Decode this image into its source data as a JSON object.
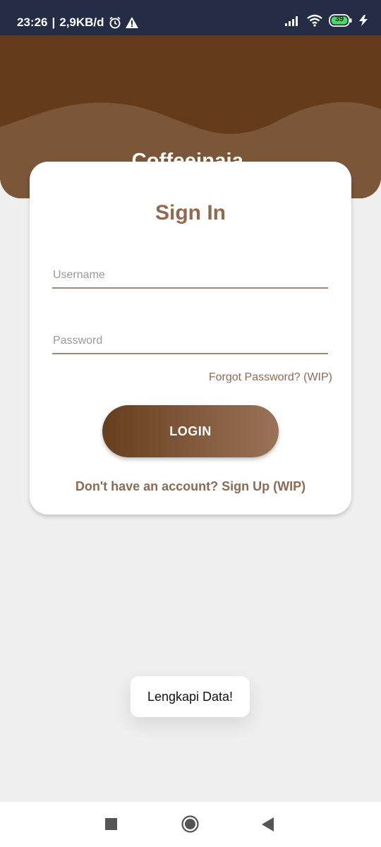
{
  "status_bar": {
    "time": "23:26",
    "network_speed": "2,9KB/d",
    "alarm_icon": "alarm-clock-icon",
    "warning_icon": "warning-triangle-icon",
    "signal_icon": "cellular-signal-icon",
    "wifi_icon": "wifi-icon",
    "battery_level": "39",
    "charging_icon": "charging-bolt-icon"
  },
  "header": {
    "app_title": "Coffeeinaja.",
    "colors": {
      "dark_brown": "#643b1b",
      "wave_brown": "#7b5639"
    }
  },
  "login_card": {
    "title": "Sign In",
    "username": {
      "value": "",
      "placeholder": "Username"
    },
    "password": {
      "value": "",
      "placeholder": "Password"
    },
    "forgot_password": "Forgot Password? (WIP)",
    "login_button": "LOGIN",
    "signup_link": "Don't have an account? Sign Up (WIP)"
  },
  "toast": {
    "message": "Lengkapi Data!"
  },
  "nav_bar": {
    "recents_icon": "square-recents-icon",
    "home_icon": "circle-home-icon",
    "back_icon": "triangle-back-icon"
  },
  "colors": {
    "accent_text": "#8f6a4e",
    "background": "#efefef",
    "status_bar": "#252c45"
  }
}
